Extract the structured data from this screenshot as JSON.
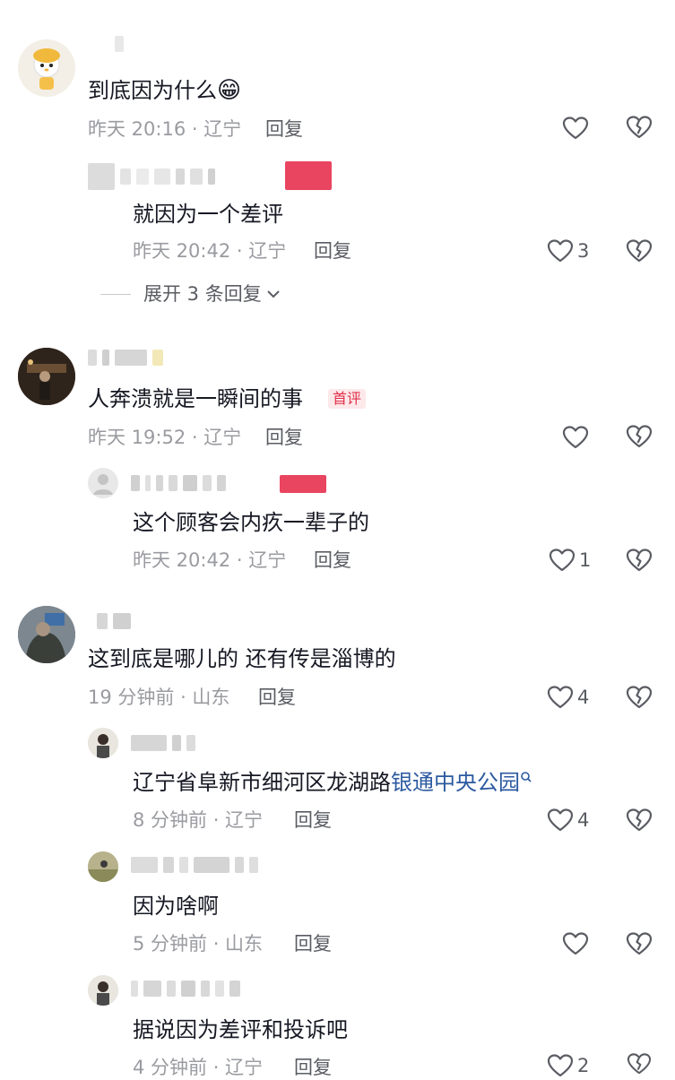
{
  "comments": [
    {
      "text": "到底因为什么",
      "emoji": "😁",
      "time": "昨天 20:16 · 辽宁",
      "reply_label": "回复",
      "likes": "",
      "replies": [
        {
          "text": "就因为一个差评",
          "time": "昨天 20:42 · 辽宁",
          "reply_label": "回复",
          "likes": "3"
        }
      ],
      "expand_label": "展开 3 条回复"
    },
    {
      "text": "人奔溃就是一瞬间的事",
      "tag": "首评",
      "time": "昨天 19:52 · 辽宁",
      "reply_label": "回复",
      "likes": "",
      "replies": [
        {
          "text": "这个顾客会内疚一辈子的",
          "time": "昨天 20:42 · 辽宁",
          "reply_label": "回复",
          "likes": "1"
        }
      ]
    },
    {
      "text": "这到底是哪儿的 还有传是淄博的",
      "time": "19 分钟前 · 山东",
      "reply_label": "回复",
      "likes": "4",
      "replies": [
        {
          "text_plain": "辽宁省阜新市细河区龙湖路",
          "text_link": "银通中央公园",
          "time": "8 分钟前 · 辽宁",
          "reply_label": "回复",
          "likes": "4"
        },
        {
          "text": "因为啥啊",
          "time": "5 分钟前 · 山东",
          "reply_label": "回复",
          "likes": ""
        },
        {
          "text": "据说因为差评和投诉吧",
          "time": "4 分钟前 · 辽宁",
          "reply_label": "回复",
          "likes": "2"
        }
      ]
    }
  ],
  "icons": {
    "like": "heart-outline-icon",
    "dislike": "broken-heart-icon",
    "link_search": "search-icon"
  },
  "colors": {
    "text": "#161823",
    "meta": "#9a9ba0",
    "link": "#2c5aa0",
    "badge": "#e94560"
  }
}
